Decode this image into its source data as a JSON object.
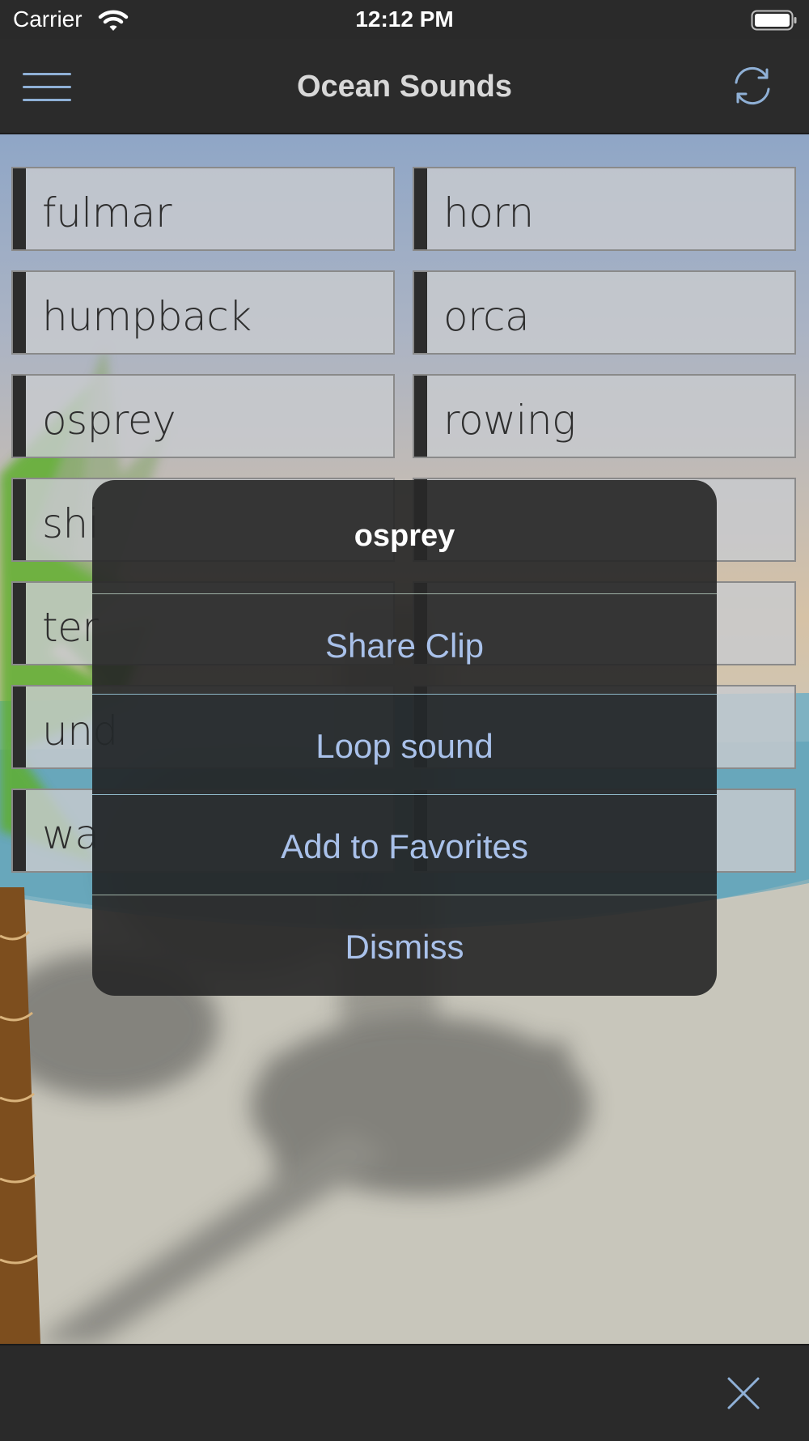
{
  "status_bar": {
    "carrier": "Carrier",
    "time": "12:12 PM"
  },
  "nav": {
    "title": "Ocean Sounds",
    "menu_icon": "hamburger-menu-icon",
    "refresh_icon": "refresh-icon"
  },
  "sounds": [
    {
      "label": "fulmar"
    },
    {
      "label": "horn"
    },
    {
      "label": "humpback"
    },
    {
      "label": "orca"
    },
    {
      "label": "osprey"
    },
    {
      "label": "rowing"
    },
    {
      "label": "shi"
    },
    {
      "label": ""
    },
    {
      "label": "ter"
    },
    {
      "label": ""
    },
    {
      "label": "und"
    },
    {
      "label": ""
    },
    {
      "label": "wa"
    },
    {
      "label": ""
    }
  ],
  "alert": {
    "title": "osprey",
    "actions": [
      {
        "label": "Share Clip"
      },
      {
        "label": "Loop sound"
      },
      {
        "label": "Add to Favorites"
      },
      {
        "label": "Dismiss"
      }
    ]
  },
  "bottom_bar": {
    "close_icon": "close-icon"
  },
  "colors": {
    "accent": "#a9c1ea",
    "bar_background": "#2a2a2a",
    "alert_background": "#282828"
  }
}
